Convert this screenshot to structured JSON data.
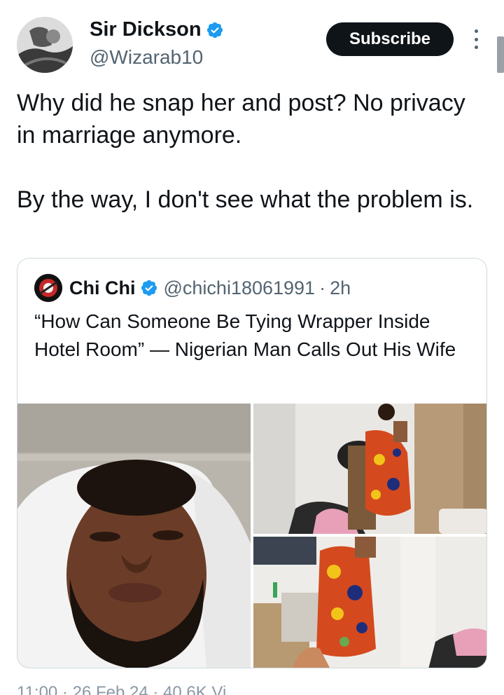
{
  "tweet": {
    "author": {
      "display_name": "Sir Dickson",
      "handle": "@Wizarab10",
      "verified": true,
      "verified_icon": "verified-badge-icon"
    },
    "subscribe_label": "Subscribe",
    "more_icon": "more-vertical-icon",
    "text_paragraphs": [
      "Why did he snap her and post? No privacy in marriage anymore.",
      "By the way, I don't see what the problem is."
    ],
    "footer_partial": "11:00 · 26 Feb 24 · 40.6K Vi"
  },
  "quote": {
    "author": {
      "display_name": "Chi Chi",
      "handle": "@chichi18061991",
      "verified": true
    },
    "separator": "·",
    "time": "2h",
    "text": "“How Can Someone Be Tying Wrapper Inside Hotel Room” — Nigerian Man Calls Out His Wife",
    "media": [
      {
        "kind": "photo",
        "subject": "selfie-man-in-bed"
      },
      {
        "kind": "photo",
        "subject": "woman-in-wrapper-hotel-room"
      },
      {
        "kind": "photo",
        "subject": "woman-in-wrapper-standing"
      }
    ]
  },
  "colors": {
    "text_primary": "#0f1419",
    "text_secondary": "#536471",
    "verified_blue": "#1d9bf0",
    "border": "#cfd9de",
    "button_bg": "#0f1419"
  }
}
